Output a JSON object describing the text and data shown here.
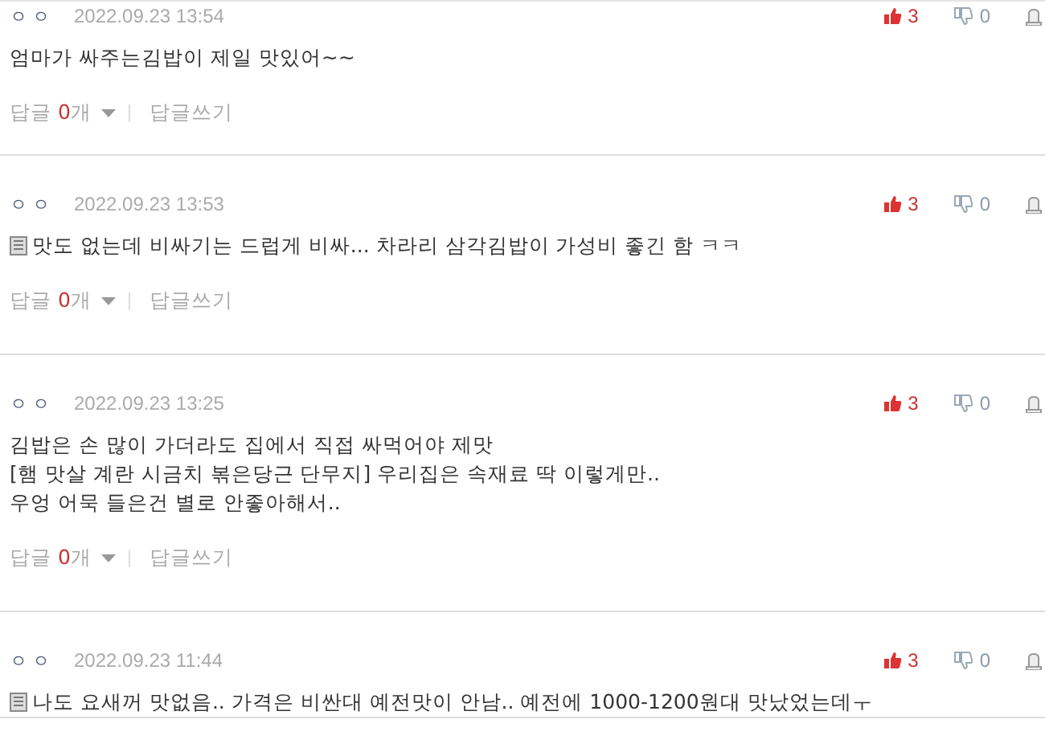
{
  "comments": [
    {
      "author": "ㅇㅇ",
      "date": "2022.09.23 13:54",
      "memo_icon": false,
      "lines": [
        "엄마가 싸주는김밥이 제일 맛있어~~"
      ],
      "up": "3",
      "down": "0",
      "reply_label": "답글",
      "reply_count": "0",
      "reply_unit": "개",
      "write_reply": "답글쓰기"
    },
    {
      "author": "ㅇㅇ",
      "date": "2022.09.23 13:53",
      "memo_icon": true,
      "lines": [
        "맛도 없는데 비싸기는 드럽게 비싸... 차라리 삼각김밥이 가성비 좋긴 함 ㅋㅋ"
      ],
      "up": "3",
      "down": "0",
      "reply_label": "답글",
      "reply_count": "0",
      "reply_unit": "개",
      "write_reply": "답글쓰기"
    },
    {
      "author": "ㅇㅇ",
      "date": "2022.09.23 13:25",
      "memo_icon": false,
      "lines": [
        "김밥은 손 많이 가더라도 집에서 직접 싸먹어야 제맛",
        "[햄 맛살 계란 시금치 볶은당근 단무지] 우리집은 속재료 딱 이렇게만..",
        "우엉 어묵 들은건 별로 안좋아해서.."
      ],
      "up": "3",
      "down": "0",
      "reply_label": "답글",
      "reply_count": "0",
      "reply_unit": "개",
      "write_reply": "답글쓰기"
    },
    {
      "author": "ㅇㅇ",
      "date": "2022.09.23 11:44",
      "memo_icon": true,
      "lines": [
        "나도 요새꺼 맛없음.. 가격은 비싼대 예전맛이 안남.. 예전에 1000-1200원대 맛났었는데ㅜ"
      ],
      "up": "3",
      "down": "0"
    }
  ]
}
